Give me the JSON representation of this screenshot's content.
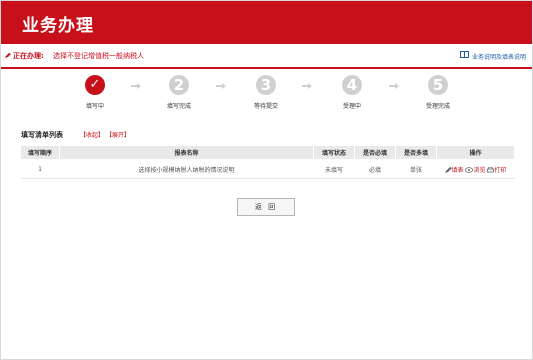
{
  "header": {
    "title": "业务办理"
  },
  "status": {
    "label": "正在办理:",
    "value": "选择不登记增值税一般纳税人",
    "help_link": "业务说明及填表说明"
  },
  "steps": [
    {
      "num": "✓",
      "label": "填写中",
      "active": true
    },
    {
      "num": "2",
      "label": "填写完成",
      "active": false
    },
    {
      "num": "3",
      "label": "等待提交",
      "active": false
    },
    {
      "num": "4",
      "label": "受理中",
      "active": false
    },
    {
      "num": "5",
      "label": "受理完成",
      "active": false
    }
  ],
  "list": {
    "title": "填写清单列表",
    "collapse": "【收起】",
    "expand": "【展开】",
    "columns": [
      "填写顺序",
      "报表名称",
      "填写状态",
      "是否必填",
      "是否多填",
      "操作"
    ],
    "rows": [
      {
        "order": "1",
        "name": "选择按小规模纳税人纳税的情况说明",
        "status": "未填写",
        "required": "必填",
        "multi": "单张",
        "actions": [
          "填表",
          "浏览",
          "打印"
        ]
      }
    ]
  },
  "buttons": {
    "return": "返 回"
  },
  "colors": {
    "brand": "#c8101a",
    "inactive_step": "#d0d0d0",
    "table_header": "#e9e9e9"
  }
}
